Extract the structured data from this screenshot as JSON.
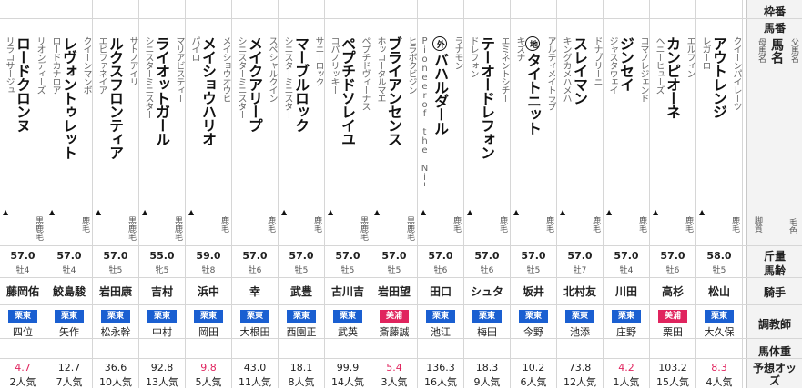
{
  "header": {
    "waku": "枠番",
    "umaban": "馬番",
    "sire_label": "父馬名",
    "name_label": "馬名",
    "dam_label": "母馬名",
    "mark_label": "脚質",
    "color_label": "毛色",
    "weight_label": "斤量",
    "age_label": "馬齢",
    "jockey_label": "騎手",
    "trainer_label": "調教師",
    "body_label": "馬体重",
    "odds_label": "予想オッズ"
  },
  "colors": {
    "kanto": "#1a5fd1",
    "kansai": "#e0245e",
    "favorite": "#e0245e"
  },
  "horses": [
    {
      "sire": "リオンディーズ",
      "name": "ロードクロンヌ",
      "dam": "リラコサージュ",
      "badge": "",
      "mark": "▲",
      "coat": "黒鹿毛",
      "weight": "57.0",
      "sexage": "牡4",
      "jockey": "藤岡佑",
      "belong": "栗東",
      "trainer": "四位",
      "odds": "4.7",
      "pop": "2人気",
      "fav": true
    },
    {
      "sire": "クイーンマンボ",
      "name": "レヴォントゥレット",
      "dam": "ロードカナロア",
      "badge": "",
      "mark": "▲",
      "coat": "鹿毛",
      "weight": "57.0",
      "sexage": "牡4",
      "jockey": "鮫島駿",
      "belong": "栗東",
      "trainer": "矢作",
      "odds": "12.7",
      "pop": "7人気",
      "fav": false
    },
    {
      "sire": "サトノアイリ",
      "name": "ルクスフロンティア",
      "dam": "エピファネイア",
      "badge": "",
      "mark": "▲",
      "coat": "黒鹿毛",
      "weight": "57.0",
      "sexage": "牡5",
      "jockey": "岩田康",
      "belong": "栗東",
      "trainer": "松永幹",
      "odds": "36.6",
      "pop": "10人気",
      "fav": false
    },
    {
      "sire": "マリアビスティー",
      "name": "ライオットガール",
      "dam": "シニスターミニスター",
      "badge": "",
      "mark": "▲",
      "coat": "黒鹿毛",
      "weight": "55.0",
      "sexage": "牝5",
      "jockey": "吉村",
      "belong": "栗東",
      "trainer": "中村",
      "odds": "92.8",
      "pop": "13人気",
      "fav": false
    },
    {
      "sire": "メイショウオウヒ",
      "name": "メイショウハリオ",
      "dam": "パイロ",
      "badge": "",
      "mark": "▲",
      "coat": "鹿毛",
      "weight": "59.0",
      "sexage": "牡8",
      "jockey": "浜中",
      "belong": "栗東",
      "trainer": "岡田",
      "odds": "9.8",
      "pop": "5人気",
      "fav": true
    },
    {
      "sire": "スペシャルクイン",
      "name": "メイクアリープ",
      "dam": "シニスターミニスター",
      "badge": "",
      "mark": "",
      "coat": "鹿毛",
      "weight": "57.0",
      "sexage": "牡6",
      "jockey": "幸",
      "belong": "栗東",
      "trainer": "大根田",
      "odds": "43.0",
      "pop": "11人気",
      "fav": false
    },
    {
      "sire": "サニーロック",
      "name": "マーブルロック",
      "dam": "シニスターミニスター",
      "badge": "",
      "mark": "▲",
      "coat": "鹿毛",
      "weight": "57.0",
      "sexage": "牡5",
      "jockey": "武豊",
      "belong": "栗東",
      "trainer": "西園正",
      "odds": "18.1",
      "pop": "8人気",
      "fav": false
    },
    {
      "sire": "ペプチドヴィーナス",
      "name": "ペプチドソレイユ",
      "dam": "コパノリッキー",
      "badge": "",
      "mark": "▲",
      "coat": "黒鹿毛",
      "weight": "57.0",
      "sexage": "牡5",
      "jockey": "古川吉",
      "belong": "栗東",
      "trainer": "武英",
      "odds": "99.9",
      "pop": "14人気",
      "fav": false
    },
    {
      "sire": "ヒラボクビジン",
      "name": "ブライアンセンス",
      "dam": "ホッコータルマエ",
      "badge": "",
      "mark": "▲",
      "coat": "黒鹿毛",
      "weight": "57.0",
      "sexage": "牡5",
      "jockey": "岩田望",
      "belong": "美浦",
      "trainer": "斎藤誠",
      "odds": "5.4",
      "pop": "3人気",
      "fav": true
    },
    {
      "sire": "ラナモン",
      "name": "バハルダール",
      "dam": "Pioneerof the Nile",
      "badge": "外",
      "mark": "▲",
      "coat": "鹿毛",
      "weight": "57.0",
      "sexage": "牡6",
      "jockey": "田口",
      "belong": "栗東",
      "trainer": "池江",
      "odds": "136.3",
      "pop": "16人気",
      "fav": false
    },
    {
      "sire": "エミネントシチー",
      "name": "テーオードレフォン",
      "dam": "ドレフォン",
      "badge": "",
      "mark": "▲",
      "coat": "鹿毛",
      "weight": "57.0",
      "sexage": "牡6",
      "jockey": "シュタ",
      "belong": "栗東",
      "trainer": "梅田",
      "odds": "18.3",
      "pop": "9人気",
      "fav": false
    },
    {
      "sire": "アルティメイトラブ",
      "name": "タイトニット",
      "dam": "キズナ",
      "badge": "地",
      "mark": "▲",
      "coat": "鹿毛",
      "weight": "57.0",
      "sexage": "牡5",
      "jockey": "坂井",
      "belong": "栗東",
      "trainer": "今野",
      "odds": "10.2",
      "pop": "6人気",
      "fav": false
    },
    {
      "sire": "ドナブリーニ",
      "name": "スレイマン",
      "dam": "キングカメハメハ",
      "badge": "",
      "mark": "▲",
      "coat": "鹿毛",
      "weight": "57.0",
      "sexage": "牡7",
      "jockey": "北村友",
      "belong": "栗東",
      "trainer": "池添",
      "odds": "73.8",
      "pop": "12人気",
      "fav": false
    },
    {
      "sire": "コマノレジェンド",
      "name": "ジンセイ",
      "dam": "ジャスタウェイ",
      "badge": "",
      "mark": "▲",
      "coat": "鹿毛",
      "weight": "57.0",
      "sexage": "牡4",
      "jockey": "川田",
      "belong": "栗東",
      "trainer": "庄野",
      "odds": "4.2",
      "pop": "1人気",
      "fav": true
    },
    {
      "sire": "エルフィン",
      "name": "カンピオーネ",
      "dam": "ヘニーヒューズ",
      "badge": "",
      "mark": "▲",
      "coat": "鹿毛",
      "weight": "57.0",
      "sexage": "牡6",
      "jockey": "高杉",
      "belong": "美浦",
      "trainer": "栗田",
      "odds": "103.2",
      "pop": "15人気",
      "fav": false
    },
    {
      "sire": "クイーンパイレーツ",
      "name": "アウトレンジ",
      "dam": "レガーロ",
      "badge": "",
      "mark": "▲",
      "coat": "鹿毛",
      "weight": "58.0",
      "sexage": "牡5",
      "jockey": "松山",
      "belong": "栗東",
      "trainer": "大久保",
      "odds": "8.3",
      "pop": "4人気",
      "fav": true
    }
  ]
}
